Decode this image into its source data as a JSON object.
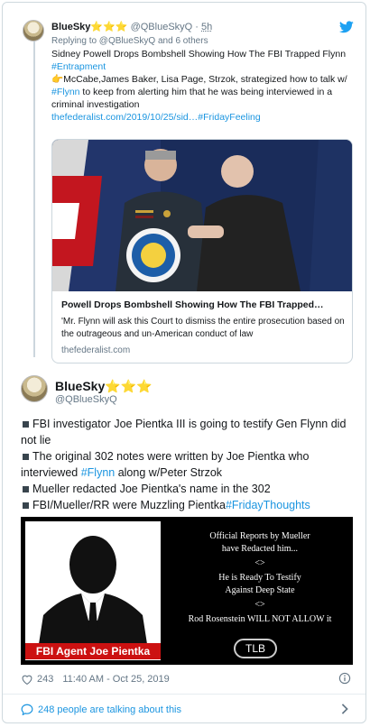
{
  "parent_tweet": {
    "name": "BlueSky",
    "name_stars": "⭐⭐⭐",
    "handle": "@QBlueSkyQ",
    "time": "5h",
    "replying_to": "Replying to @QBlueSkyQ and 6 others",
    "line1": "Sidney Powell Drops Bombshell Showing How The FBI Trapped Flynn ",
    "hashtag1": "#Entrapment",
    "pointer_emoji": "👉",
    "line2": "McCabe,James Baker, Lisa Page, Strzok, strategized how to talk w/ ",
    "hashtag2": "#Flynn",
    "line3": " to keep from alerting him that he was being interviewed in a criminal investigation",
    "link_text": "thefederalist.com/2019/10/25/sid…",
    "hashtag3": "#FridayFeeling",
    "card": {
      "title": "Powell Drops Bombshell Showing How The FBI Trapped…",
      "description": "'Mr. Flynn will ask this Court to dismiss the entire prosecution based on the outrageous and un-American conduct of law",
      "domain": "thefederalist.com"
    }
  },
  "main_tweet": {
    "name": "BlueSky",
    "name_stars": "⭐⭐⭐",
    "handle": "@QBlueSkyQ",
    "bullets": [
      {
        "text": "FBI investigator Joe Pientka III is going to testify Gen Flynn did not lie"
      },
      {
        "text": "The original 302 notes were written by Joe Pientka who interviewed ",
        "hashtag": "#Flynn",
        "after": " along w/Peter Strzok"
      },
      {
        "text": "Mueller redacted Joe Pientka's name in the 302"
      },
      {
        "text": "FBI/Mueller/RR were Muzzling Pientka",
        "hashtag": "#FridayThoughts"
      }
    ],
    "image": {
      "label": "FBI Agent Joe Pientka",
      "line1": "Official Reports by Mueller",
      "line2": "have Redacted him...",
      "sep1": "<>",
      "line3": "He is Ready To Testify",
      "line4": "Against Deep State",
      "sep2": "<>",
      "line5": "Rod Rosenstein WILL NOT ALLOW it",
      "logo": "TLB"
    },
    "likes": "243",
    "timestamp": "11:40 AM - Oct 25, 2019",
    "talking": "248 people are talking about this"
  },
  "colors": {
    "link": "#1b95e0",
    "twitter_blue": "#1da1f2",
    "muted": "#657786"
  },
  "icons": {
    "logo": "twitter-bird-icon",
    "like": "heart-icon",
    "info": "info-icon",
    "comments": "speech-bubble-icon",
    "expand": "chevron-right-icon"
  }
}
